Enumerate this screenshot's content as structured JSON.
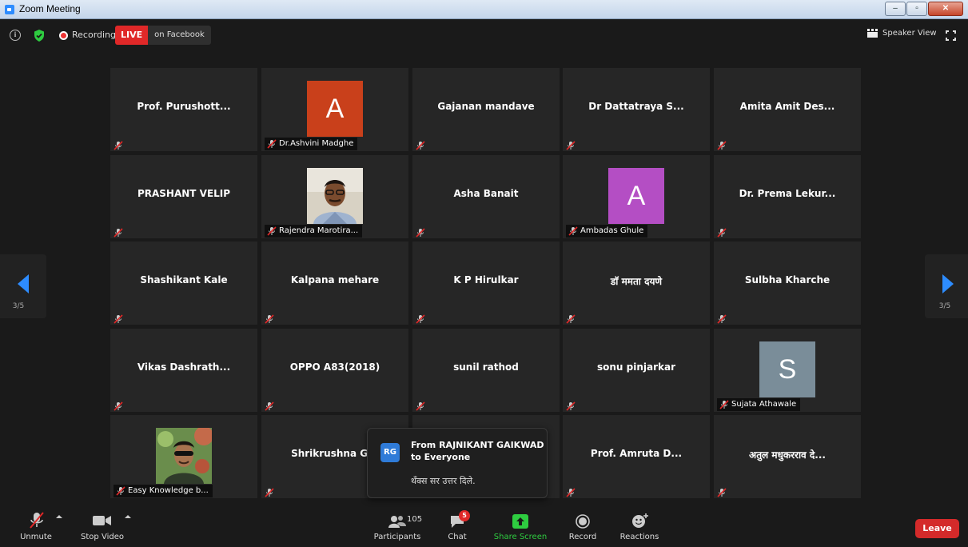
{
  "window": {
    "title": "Zoom Meeting",
    "minimize": "–",
    "restore": "▫",
    "close": "✕"
  },
  "topbar": {
    "recording_label": "Recording",
    "live_label": "LIVE",
    "live_destination": "on Facebook",
    "speaker_view_label": "Speaker View",
    "info_glyph": "i"
  },
  "colors": {
    "accent": "#2d8cff",
    "live": "#e02828",
    "leave": "#d42a2a",
    "share": "#2ecc40"
  },
  "tiles": [
    {
      "name": "Prof. Purushott..."
    },
    {
      "name": "Dr.Ashvini Madghe",
      "avatar_letter": "A",
      "avatar_color": "#c9401b"
    },
    {
      "name": "Gajanan mandave"
    },
    {
      "name": "Dr Dattatraya S..."
    },
    {
      "name": "Amita Amit Des..."
    },
    {
      "name": "PRASHANT VELIP"
    },
    {
      "name": "Rajendra Marotira...",
      "photo": "man-with-glasses-photo"
    },
    {
      "name": "Asha Banait"
    },
    {
      "name": "Ambadas Ghule",
      "avatar_letter": "A",
      "avatar_color": "#b44ec4"
    },
    {
      "name": "Dr. Prema Lekur..."
    },
    {
      "name": "Shashikant Kale"
    },
    {
      "name": "Kalpana mehare"
    },
    {
      "name": "K P Hirulkar"
    },
    {
      "name": "डाॅ ममता दयणे"
    },
    {
      "name": "Sulbha Kharche"
    },
    {
      "name": "Vikas Dashrath..."
    },
    {
      "name": "OPPO A83(2018)"
    },
    {
      "name": "sunil rathod"
    },
    {
      "name": "sonu pinjarkar"
    },
    {
      "name": "Sujata Athawale",
      "avatar_letter": "S",
      "avatar_color": "#7a8d99"
    },
    {
      "name": "Easy Knowledge b...",
      "photo": "man-sunglasses-photo"
    },
    {
      "name": "Shrikrushna  G.K"
    },
    {
      "name": ""
    },
    {
      "name": "Prof. Amruta D..."
    },
    {
      "name": "अतुल मधुकरराव दे..."
    }
  ],
  "pagination": {
    "left": "3/5",
    "right": "3/5"
  },
  "chat_popup": {
    "avatar_initials": "RG",
    "from_line1": "From RAJNIKANT GAIKWAD",
    "from_line2": "to Everyone",
    "message": "थँक्स सर उत्तर दिले."
  },
  "toolbar": {
    "unmute": "Unmute",
    "stop_video": "Stop Video",
    "participants": "Participants",
    "participants_count": "105",
    "chat": "Chat",
    "chat_badge": "5",
    "share_screen": "Share Screen",
    "record": "Record",
    "reactions": "Reactions",
    "leave": "Leave"
  }
}
